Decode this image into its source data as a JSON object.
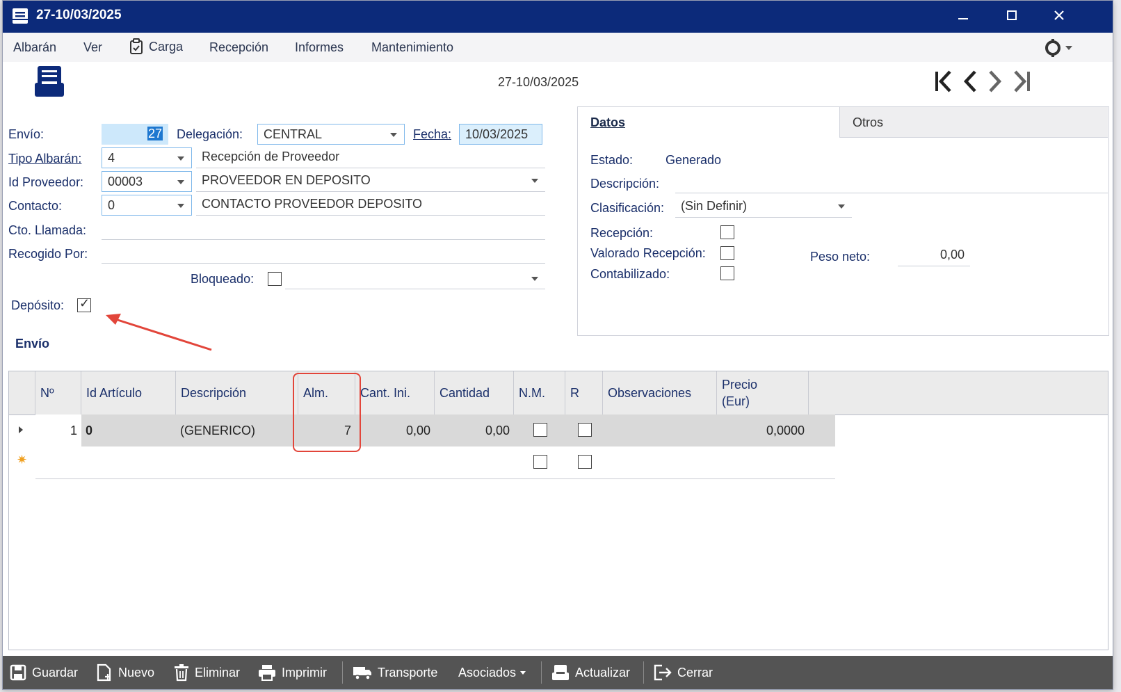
{
  "window": {
    "title": "27-10/03/2025"
  },
  "menu": {
    "albaran": "Albarán",
    "ver": "Ver",
    "carga": "Carga",
    "recepcion": "Recepción",
    "informes": "Informes",
    "mantenimiento": "Mantenimiento"
  },
  "header": {
    "doc_title": "27-10/03/2025"
  },
  "form": {
    "envio_label": "Envío:",
    "envio_value": "27",
    "delegacion_label": "Delegación:",
    "delegacion_value": "CENTRAL",
    "fecha_label": "Fecha:",
    "fecha_value": "10/03/2025",
    "tipo_label": "Tipo Albarán:",
    "tipo_value": "4",
    "tipo_desc": "Recepción de Proveedor",
    "proveedor_label": "Id Proveedor:",
    "proveedor_value": "00003",
    "proveedor_desc": "PROVEEDOR EN DEPOSITO",
    "contacto_label": "Contacto:",
    "contacto_value": "0",
    "contacto_desc": "CONTACTO PROVEEDOR DEPOSITO",
    "llamada_label": "Cto. Llamada:",
    "recogido_label": "Recogido Por:",
    "bloqueado_label": "Bloqueado:",
    "deposito_label": "Depósito:"
  },
  "panel": {
    "tab_datos": "Datos",
    "tab_otros": "Otros",
    "estado_label": "Estado:",
    "estado_value": "Generado",
    "descripcion_label": "Descripción:",
    "clasificacion_label": "Clasificación:",
    "clasificacion_value": "(Sin Definir)",
    "recepcion_label": "Recepción:",
    "valorado_label": "Valorado Recepción:",
    "contabilizado_label": "Contabilizado:",
    "peso_label": "Peso neto:",
    "peso_value": "0,00"
  },
  "grid": {
    "section_title": "Envío",
    "columns": [
      "Nº",
      "Id Artículo",
      "Descripción",
      "Alm.",
      "Cant. Ini.",
      "Cantidad",
      "N.M.",
      "R",
      "Observaciones",
      "Precio\n(Eur)"
    ],
    "row": {
      "n": "1",
      "id": "0",
      "desc": "(GENERICO)",
      "alm": "7",
      "cant_ini": "0,00",
      "cantidad": "0,00",
      "precio": "0,0000"
    }
  },
  "toolbar": {
    "guardar": "Guardar",
    "nuevo": "Nuevo",
    "eliminar": "Eliminar",
    "imprimir": "Imprimir",
    "transporte": "Transporte",
    "asociados": "Asociados",
    "actualizar": "Actualizar",
    "cerrar": "Cerrar"
  },
  "colors": {
    "titlebar": "#0c2a7a",
    "highlight": "#e2453a",
    "toolbar": "#545454"
  }
}
